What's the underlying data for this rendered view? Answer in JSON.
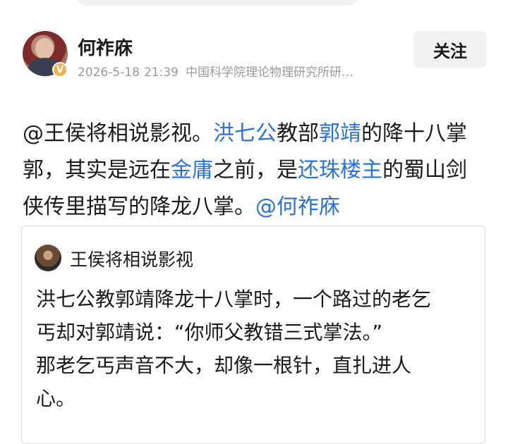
{
  "post": {
    "author": "何祚庥",
    "date": "2026-5-18",
    "time": "21:39",
    "source": "中国科学院理论物理研究所研…",
    "follow_label": "关注",
    "verified_icon": "V",
    "body": {
      "mention_1": "@王侯将相说影视",
      "t1": "。",
      "link_1": "洪七公",
      "t2": "教部",
      "link_2": "郭靖",
      "t3": "的降十八掌郭，其实是远在",
      "link_3": "金庸",
      "t4": "之前，是",
      "link_4": "还珠楼主",
      "t5": "的蜀山剑侠传里描写的降龙八掌。",
      "mention_2": "@何祚庥"
    }
  },
  "quote": {
    "author": "王侯将相说影视",
    "line_1": "洪七公教郭靖降龙十八掌时，一个路过的老乞",
    "line_2": "丐却对郭靖说：“你师父教错三式掌法。”",
    "line_3": "那老乞丐声音不大，却像一根针，直扎进人",
    "line_4": "心。"
  },
  "colors": {
    "link": "#2a72d9",
    "meta": "#9a9a9a",
    "badge": "#e8b64c"
  }
}
